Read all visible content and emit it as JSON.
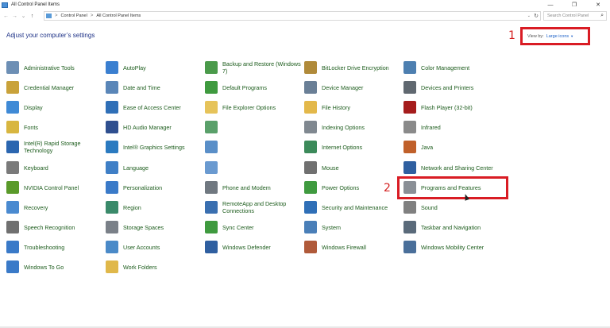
{
  "window": {
    "title": "All Control Panel Items",
    "minimize": "—",
    "maximize": "❐",
    "close": "✕"
  },
  "nav": {
    "back": "←",
    "forward": "→",
    "recent": "⌄",
    "up": "↑"
  },
  "address": {
    "crumbs": [
      "Control Panel",
      "All Control Panel Items"
    ],
    "separator": ">",
    "dropdown": "⌄",
    "refresh": "↻"
  },
  "search": {
    "placeholder": "Search Control Panel",
    "icon": "⌕"
  },
  "heading": "Adjust your computer’s settings",
  "view_by": {
    "label": "View by:",
    "value": "Large icons",
    "caret": "▼"
  },
  "annotations": {
    "one": "1",
    "two": "2"
  },
  "items": [
    {
      "label": "Administrative Tools",
      "icon": "tools-icon",
      "color": "#6d8fb5"
    },
    {
      "label": "AutoPlay",
      "icon": "autoplay-icon",
      "color": "#3a7fd0"
    },
    {
      "label": "Backup and Restore (Windows 7)",
      "icon": "backup-icon",
      "color": "#4a9a4a"
    },
    {
      "label": "BitLocker Drive Encryption",
      "icon": "bitlocker-icon",
      "color": "#b08a3a"
    },
    {
      "label": "Color Management",
      "icon": "color-management-icon",
      "color": "#4d7fb0"
    },
    {
      "label": "Credential Manager",
      "icon": "credential-icon",
      "color": "#c9a23a"
    },
    {
      "label": "Date and Time",
      "icon": "clock-icon",
      "color": "#5a86b8"
    },
    {
      "label": "Default Programs",
      "icon": "default-programs-icon",
      "color": "#3f9a3f"
    },
    {
      "label": "Device Manager",
      "icon": "device-manager-icon",
      "color": "#6a7f96"
    },
    {
      "label": "Devices and Printers",
      "icon": "printer-icon",
      "color": "#606870"
    },
    {
      "label": "Display",
      "icon": "display-icon",
      "color": "#3f8ad6"
    },
    {
      "label": "Ease of Access Center",
      "icon": "ease-of-access-icon",
      "color": "#2f6fb7"
    },
    {
      "label": "File Explorer Options",
      "icon": "folder-options-icon",
      "color": "#e6c35a"
    },
    {
      "label": "File History",
      "icon": "file-history-icon",
      "color": "#e3b84a"
    },
    {
      "label": "Flash Player (32-bit)",
      "icon": "flash-icon",
      "color": "#a51c1c"
    },
    {
      "label": "Fonts",
      "icon": "fonts-icon",
      "color": "#d8b640"
    },
    {
      "label": "HD Audio Manager",
      "icon": "audio-manager-icon",
      "color": "#2f4f8f"
    },
    {
      "label": "",
      "icon": "network-icon",
      "color": "#5aa06a"
    },
    {
      "label": "Indexing Options",
      "icon": "indexing-icon",
      "color": "#808890"
    },
    {
      "label": "Infrared",
      "icon": "infrared-icon",
      "color": "#8a8a8a"
    },
    {
      "label": "Intel(R) Rapid Storage Technology",
      "icon": "intel-storage-icon",
      "color": "#2b66b0"
    },
    {
      "label": "Intel® Graphics Settings",
      "icon": "intel-graphics-icon",
      "color": "#2b7ac0"
    },
    {
      "label": "",
      "icon": "globe-icon",
      "color": "#5a8fc8"
    },
    {
      "label": "Internet Options",
      "icon": "internet-options-icon",
      "color": "#3c8a5a"
    },
    {
      "label": "Java",
      "icon": "java-icon",
      "color": "#c0602a"
    },
    {
      "label": "Keyboard",
      "icon": "keyboard-icon",
      "color": "#7a7a7a"
    },
    {
      "label": "Language",
      "icon": "language-icon",
      "color": "#3f7fc6"
    },
    {
      "label": "",
      "icon": "globe-icon",
      "color": "#6a9ad0"
    },
    {
      "label": "Mouse",
      "icon": "mouse-icon",
      "color": "#707070"
    },
    {
      "label": "Network and Sharing Center",
      "icon": "network-sharing-icon",
      "color": "#2f5fa0"
    },
    {
      "label": "NVIDIA Control Panel",
      "icon": "nvidia-icon",
      "color": "#5a9a2a"
    },
    {
      "label": "Personalization",
      "icon": "personalization-icon",
      "color": "#3a7ac8"
    },
    {
      "label": "Phone and Modem",
      "icon": "phone-icon",
      "color": "#707880"
    },
    {
      "label": "Power Options",
      "icon": "power-icon",
      "color": "#3f9a3f"
    },
    {
      "label": "Programs and Features",
      "icon": "programs-icon",
      "color": "#8a8f96"
    },
    {
      "label": "Recovery",
      "icon": "recovery-icon",
      "color": "#4a8ad0"
    },
    {
      "label": "Region",
      "icon": "region-icon",
      "color": "#3a8a6a"
    },
    {
      "label": "RemoteApp and Desktop Connections",
      "icon": "remoteapp-icon",
      "color": "#3a6fb0"
    },
    {
      "label": "Security and Maintenance",
      "icon": "flag-icon",
      "color": "#2f6fb7"
    },
    {
      "label": "Sound",
      "icon": "sound-icon",
      "color": "#808080"
    },
    {
      "label": "Speech Recognition",
      "icon": "microphone-icon",
      "color": "#707070"
    },
    {
      "label": "Storage Spaces",
      "icon": "storage-spaces-icon",
      "color": "#7a8088"
    },
    {
      "label": "Sync Center",
      "icon": "sync-icon",
      "color": "#3f9a3f"
    },
    {
      "label": "System",
      "icon": "system-icon",
      "color": "#4a7fb8"
    },
    {
      "label": "Taskbar and Navigation",
      "icon": "taskbar-icon",
      "color": "#5a6a7a"
    },
    {
      "label": "Troubleshooting",
      "icon": "troubleshooting-icon",
      "color": "#3a7ac8"
    },
    {
      "label": "User Accounts",
      "icon": "user-accounts-icon",
      "color": "#4a8ac8"
    },
    {
      "label": "Windows Defender",
      "icon": "defender-icon",
      "color": "#2f5fa0"
    },
    {
      "label": "Windows Firewall",
      "icon": "firewall-icon",
      "color": "#b05a3a"
    },
    {
      "label": "Windows Mobility Center",
      "icon": "mobility-icon",
      "color": "#4a6f9a"
    },
    {
      "label": "Windows To Go",
      "icon": "windows-to-go-icon",
      "color": "#3a7ac8"
    },
    {
      "label": "Work Folders",
      "icon": "work-folders-icon",
      "color": "#e0b84a"
    }
  ]
}
